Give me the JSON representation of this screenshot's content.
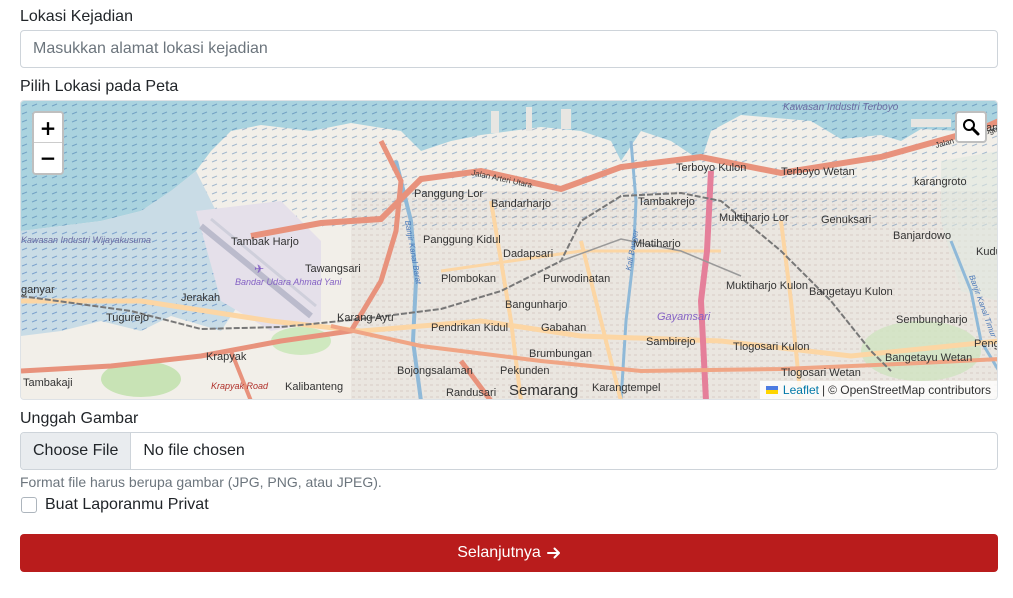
{
  "location": {
    "label": "Lokasi Kejadian",
    "placeholder": "Masukkan alamat lokasi kejadian",
    "value": ""
  },
  "map": {
    "label": "Pilih Lokasi pada Peta",
    "zoom_in": "+",
    "zoom_out": "−",
    "attribution": {
      "leaflet": "Leaflet",
      "separator": "|",
      "copyright": "© OpenStreetMap contributors"
    },
    "places": [
      "Kawasan Industri Terboyo",
      "Sriwulan",
      "Jalan Raya Kaligawe",
      "Terboyo Kulon",
      "Terboyo Wetan",
      "karangroto",
      "Panggung Lor",
      "Jalan Arteri Utara",
      "Bandarharjo",
      "Tambakrejo",
      "Muktiharjo Lor",
      "Genuksari",
      "Tambak Harjo",
      "Panggung Kidul",
      "Dadapsari",
      "Mlatiharjo",
      "Banjardowo",
      "Tawangsari",
      "Bandar Udara Ahmad Yani",
      "Plombokan",
      "Purwodinatan",
      "Jerakah",
      "Muktiharjo Kulon",
      "Bangetayu Kulon",
      "Tugurejo",
      "Bangunharjo",
      "Karang Ayu",
      "Pendrikan Kidul",
      "Gabahan",
      "Gayamsari",
      "Sembungharjo",
      "Krapyak",
      "Sambirejo",
      "Tlogosari Kulon",
      "Brumbungan",
      "Bangetayu Wetan",
      "Tambakaji",
      "Kalibanteng",
      "Bojongsalaman",
      "Pekunden",
      "Tlogosari Wetan",
      "Randusari",
      "Semarang",
      "Karangtempel",
      "Banjir Kanal Barat",
      "Kali Banger",
      "Banjir Kanal Timur",
      "Kudu",
      "Pengga",
      "ganyar",
      "Kawasan Industri Wijayakusuma",
      "Krapyak Road"
    ]
  },
  "upload": {
    "label": "Unggah Gambar",
    "button": "Choose File",
    "status": "No file chosen",
    "hint": "Format file harus berupa gambar (JPG, PNG, atau JPEG)."
  },
  "privacy": {
    "label": "Buat Laporanmu Privat",
    "checked": false
  },
  "submit": {
    "label": "Selanjutnya",
    "icon": "arrow-right-icon"
  },
  "colors": {
    "primary": "#b91c1c",
    "water": "#aad3df",
    "land": "#f2efe9",
    "major_road": "#e8927c",
    "trunk_road": "#f9b29c",
    "secondary_road": "#fcd6a4",
    "railway": "#777777",
    "leaflet_link": "#0078a8"
  }
}
